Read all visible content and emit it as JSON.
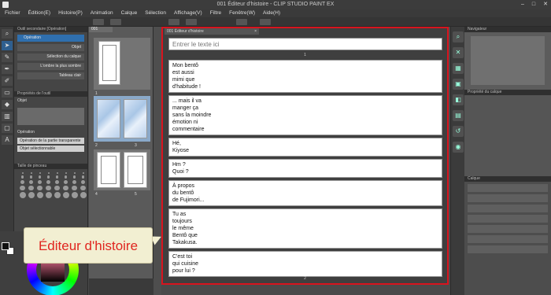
{
  "window": {
    "title": "001 Éditeur d'histoire - CLIP STUDIO PAINT EX"
  },
  "menu": [
    "Fichier",
    "Édition(E)",
    "Histoire(P)",
    "Animation",
    "Calque",
    "Sélection",
    "Affichage(V)",
    "Filtre",
    "Fenêtre(W)",
    "Aide(H)"
  ],
  "subtool": {
    "title": "Outil secondaire [Opération]",
    "items": [
      "Opération",
      "Objet",
      "Sélection du calque",
      "L'ombre la plus sombre",
      "Tableau clair"
    ]
  },
  "tool_property": {
    "title": "Propriétés de l'outil",
    "mode": "Objet",
    "operation_label": "Opération",
    "field1": "Opération de la partie transparente",
    "field2": "Objet sélectionnable"
  },
  "brush": {
    "title": "Taille de pinceau"
  },
  "pages_panel": {
    "tab": "001",
    "page_numbers": [
      "1",
      "2",
      "3",
      "4",
      "5"
    ]
  },
  "story_editor": {
    "tab_label": "001 Éditeur d'histoire",
    "input_placeholder": "Entrer le texte ici",
    "top_page_num": "1",
    "bottom_page_num": "2",
    "entries": [
      "Mon bentô\nest aussi\nmimi que\nd'habitude !",
      "... mais il va\nmanger ça\nsans la moindre\némotion ni\ncommentaire",
      "Hé,\nKiyose",
      "Hm ?\nQuoi ?",
      "À propos\ndu bentô\nde Fujimori...",
      "Tu as\ntoujours\nle même\nBentô que\nTakakusa.",
      "C'est toi\nqui cuisine\npour lui ?"
    ]
  },
  "right_panel": {
    "navigator": "Navigateur",
    "layer_property": "Propriété du calque",
    "layers": "Calque"
  },
  "callout": {
    "text": "Éditeur d'histoire"
  },
  "colors": {
    "highlight": "#d8141e",
    "callout_bg": "#f2efd2",
    "callout_text": "#e0251f"
  }
}
